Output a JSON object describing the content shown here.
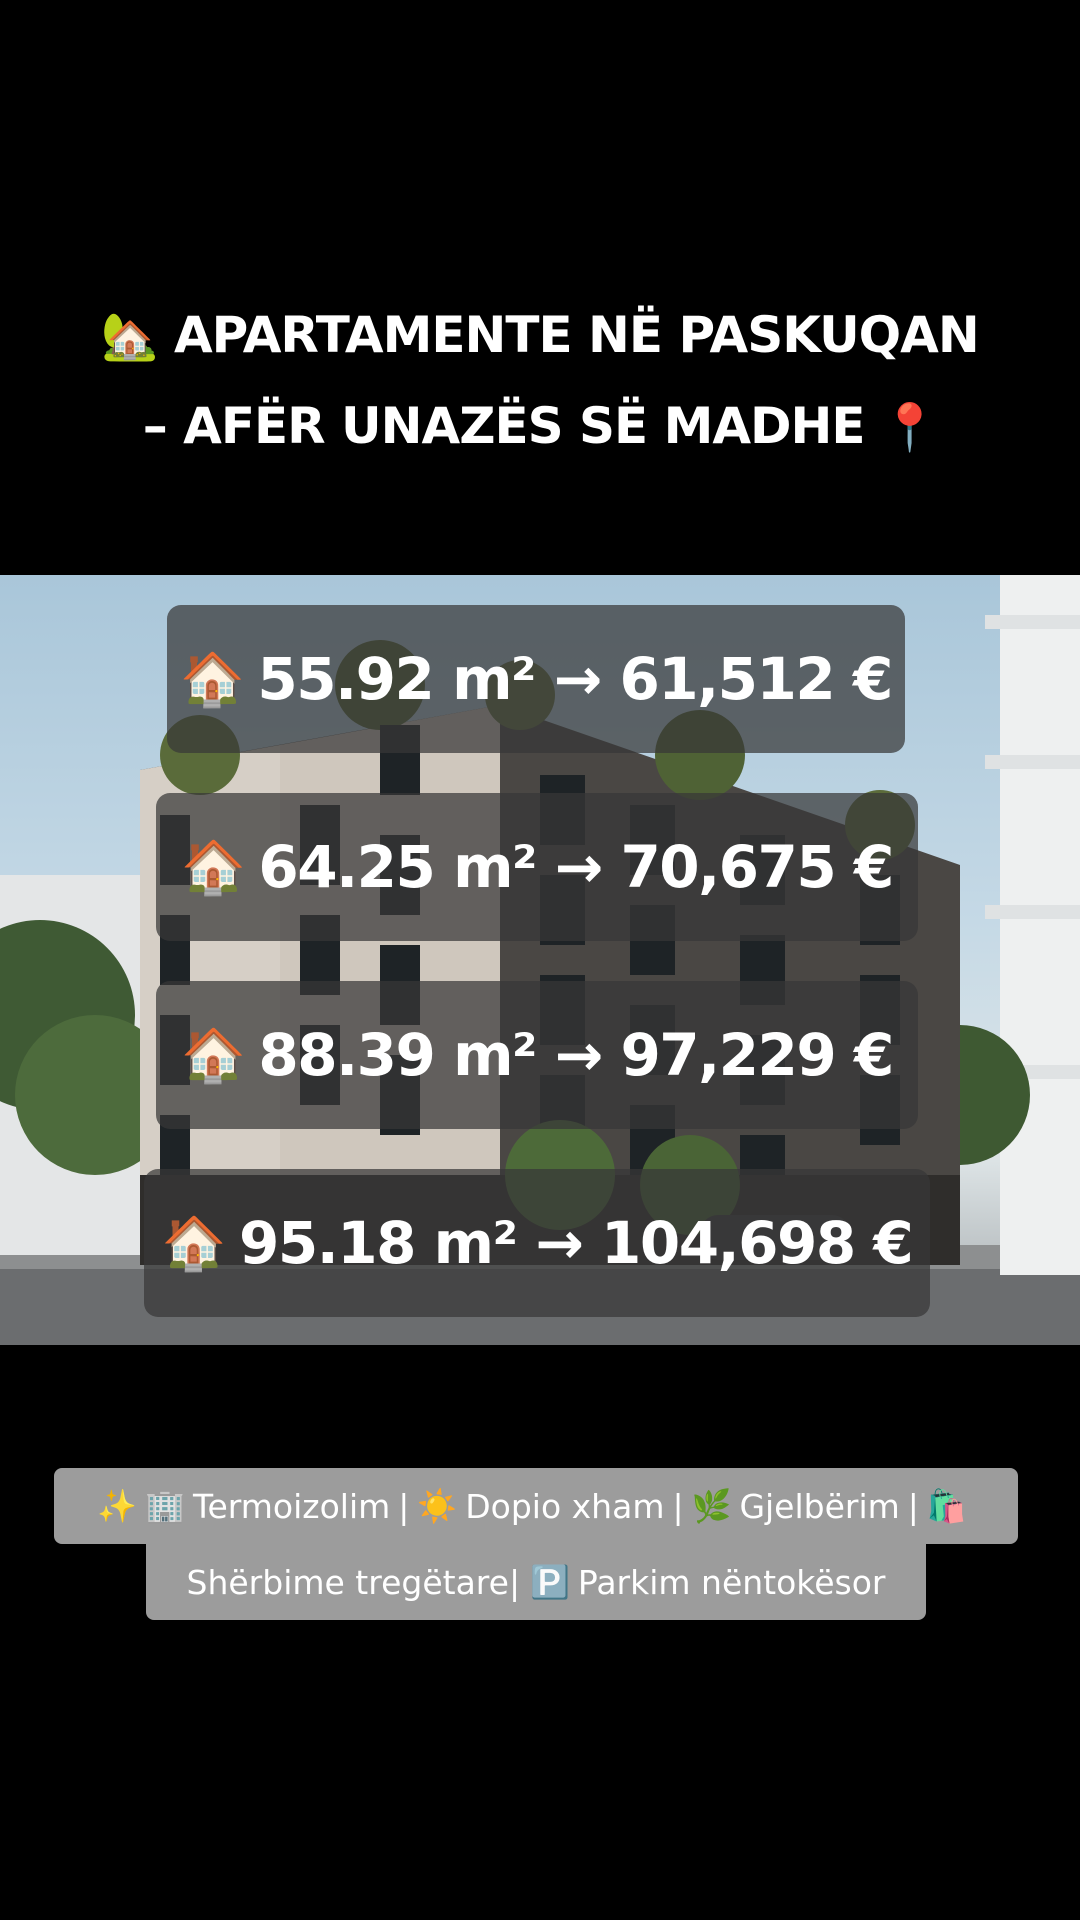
{
  "title": {
    "line1_emoji": "🏡",
    "line1_text": "APARTAMENTE NË PASKUQAN",
    "line2_text": "– AFËR UNAZËS SË MADHE",
    "line2_emoji": "📍"
  },
  "listings": [
    {
      "icon": "🏠",
      "area": "55.92 m²",
      "arrow": "→",
      "price": "61,512 €"
    },
    {
      "icon": "🏠",
      "area": "64.25 m²",
      "arrow": "→",
      "price": "70,675 €"
    },
    {
      "icon": "🏠",
      "area": "88.39 m²",
      "arrow": "→",
      "price": "97,229 €"
    },
    {
      "icon": "🏠",
      "area": "95.18 m²",
      "arrow": "→",
      "price": "104,698 €"
    }
  ],
  "features": {
    "row1": [
      {
        "icon": "✨",
        "label": ""
      },
      {
        "icon": "🏢",
        "label": "Termoizolim"
      },
      {
        "icon": "☀️",
        "label": "Dopio xham"
      },
      {
        "icon": "🌿",
        "label": "Gjelbërim"
      },
      {
        "icon": "🛍️",
        "label": ""
      }
    ],
    "row2": [
      {
        "icon": "",
        "label": "Shërbime tregëtare|"
      },
      {
        "icon": "🅿️",
        "label": "Parkim nëntokësor"
      }
    ],
    "separator": "|"
  }
}
